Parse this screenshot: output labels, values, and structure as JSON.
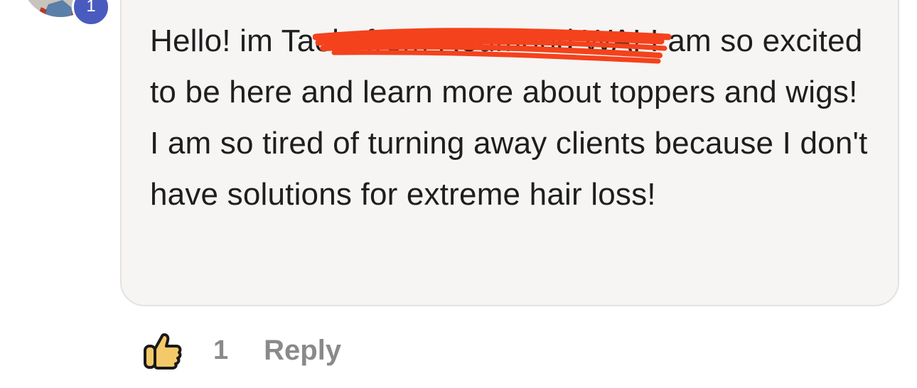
{
  "avatar": {
    "badge_count": "1",
    "badge_color": "#4a5bbf"
  },
  "comment": {
    "text": "Hello! im Taela from Redmond WA! I am so excited to be here and learn more about toppers and wigs! I am so tired of turning away clients because I don't have solutions for extreme hair loss!",
    "redaction_color": "#f4421c",
    "bubble_color": "#f6f5f4"
  },
  "actions": {
    "like_icon": "thumbs-up-icon",
    "like_count": "1",
    "reply_label": "Reply"
  }
}
